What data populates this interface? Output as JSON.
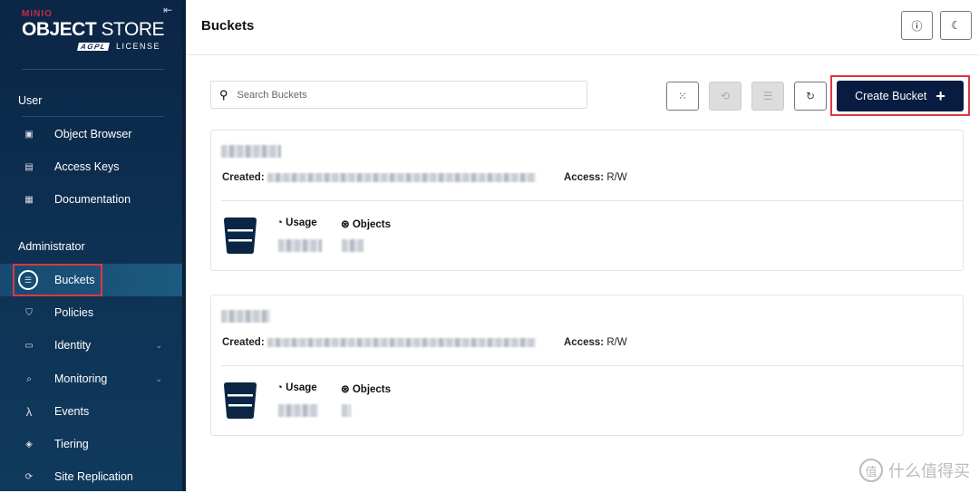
{
  "sidebar": {
    "logo": {
      "brand": "MINIO",
      "product_bold": "OBJECT",
      "product_light": "STORE",
      "badge": "AGPL",
      "license": "LICENSE"
    },
    "sections": [
      {
        "title": "User",
        "items": [
          {
            "label": "Object Browser",
            "icon": "object-browser-icon"
          },
          {
            "label": "Access Keys",
            "icon": "key-icon"
          },
          {
            "label": "Documentation",
            "icon": "document-icon"
          }
        ]
      },
      {
        "title": "Administrator",
        "items": [
          {
            "label": "Buckets",
            "icon": "bucket-icon",
            "active": true
          },
          {
            "label": "Policies",
            "icon": "shield-icon"
          },
          {
            "label": "Identity",
            "icon": "identity-icon",
            "expandable": true
          },
          {
            "label": "Monitoring",
            "icon": "monitoring-icon",
            "expandable": true
          },
          {
            "label": "Events",
            "icon": "lambda-icon"
          },
          {
            "label": "Tiering",
            "icon": "layers-icon"
          },
          {
            "label": "Site Replication",
            "icon": "replication-icon"
          }
        ]
      }
    ]
  },
  "header": {
    "title": "Buckets"
  },
  "toolbar": {
    "search_placeholder": "Search Buckets",
    "create_label": "Create Bucket"
  },
  "buckets": [
    {
      "access_label": "Created:",
      "access_key": "Access:",
      "access": "R/W",
      "usage_label": "Usage",
      "objects_label": "Objects"
    },
    {
      "access_label": "Created:",
      "access_key": "Access:",
      "access": "R/W",
      "usage_label": "Usage",
      "objects_label": "Objects"
    }
  ],
  "colors": {
    "sidebar": "#0b2545",
    "primary": "#081c42",
    "highlight": "#e0373e"
  },
  "watermark": "什么值得买"
}
